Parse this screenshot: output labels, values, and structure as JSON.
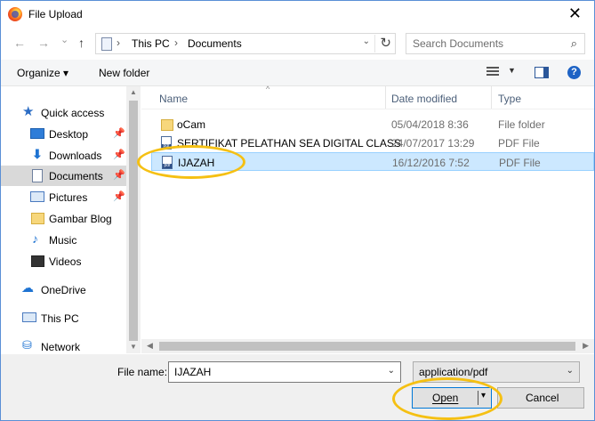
{
  "titlebar": {
    "title": "File Upload",
    "close_glyph": "✕",
    "app_icon": "firefox-icon"
  },
  "nav": {
    "back_glyph": "←",
    "forward_glyph": "→",
    "recent_glyph": "⌄",
    "up_glyph": "↑",
    "address": {
      "sep": "›",
      "crumbs": [
        "This PC",
        "Documents"
      ],
      "dropdown_glyph": "⌄",
      "refresh_glyph": "↻"
    },
    "search": {
      "placeholder": "Search Documents",
      "icon_glyph": "⌕"
    }
  },
  "toolbar": {
    "organize": "Organize ▾",
    "new_folder": "New folder",
    "view_dd": "▼",
    "help": "?"
  },
  "sidebar": {
    "items": [
      {
        "label": "Quick access",
        "icon": "star-icon"
      },
      {
        "label": "Desktop",
        "icon": "desktop-icon",
        "pinned": true
      },
      {
        "label": "Downloads",
        "icon": "download-icon",
        "pinned": true
      },
      {
        "label": "Documents",
        "icon": "documents-icon",
        "pinned": true,
        "selected": true
      },
      {
        "label": "Pictures",
        "icon": "pictures-icon",
        "pinned": true
      },
      {
        "label": "Gambar Blog",
        "icon": "folder-icon"
      },
      {
        "label": "Music",
        "icon": "music-icon"
      },
      {
        "label": "Videos",
        "icon": "videos-icon"
      },
      {
        "label": "OneDrive",
        "icon": "cloud-icon"
      },
      {
        "label": "This PC",
        "icon": "computer-icon"
      },
      {
        "label": "Network",
        "icon": "network-icon"
      }
    ],
    "pin_glyph": "📌"
  },
  "columns": {
    "name": "Name",
    "date": "Date modified",
    "type": "Type",
    "sort_glyph": "^"
  },
  "files": [
    {
      "name": "oCam",
      "date": "05/04/2018 8:36",
      "type": "File folder",
      "icon": "folder-icon"
    },
    {
      "name": "SERTIFIKAT PELATHAN SEA DIGITAL CLASS",
      "date": "24/07/2017 13:29",
      "type": "PDF File",
      "icon": "pdf-icon"
    },
    {
      "name": "IJAZAH",
      "date": "16/12/2016 7:52",
      "type": "PDF File",
      "icon": "pdf-icon",
      "selected": true
    }
  ],
  "scroll": {
    "up": "▲",
    "down": "▼",
    "left": "◀",
    "right": "▶"
  },
  "bottom": {
    "file_name_label": "File name:",
    "file_name_value": "IJAZAH",
    "dropdown_glyph": "⌄",
    "filter_value": "application/pdf",
    "open_label": "Open",
    "open_arrow": "▾",
    "cancel_label": "Cancel"
  },
  "colors": {
    "highlight": "#f5c013",
    "selection": "#cce8ff",
    "accent": "#0078d7"
  }
}
